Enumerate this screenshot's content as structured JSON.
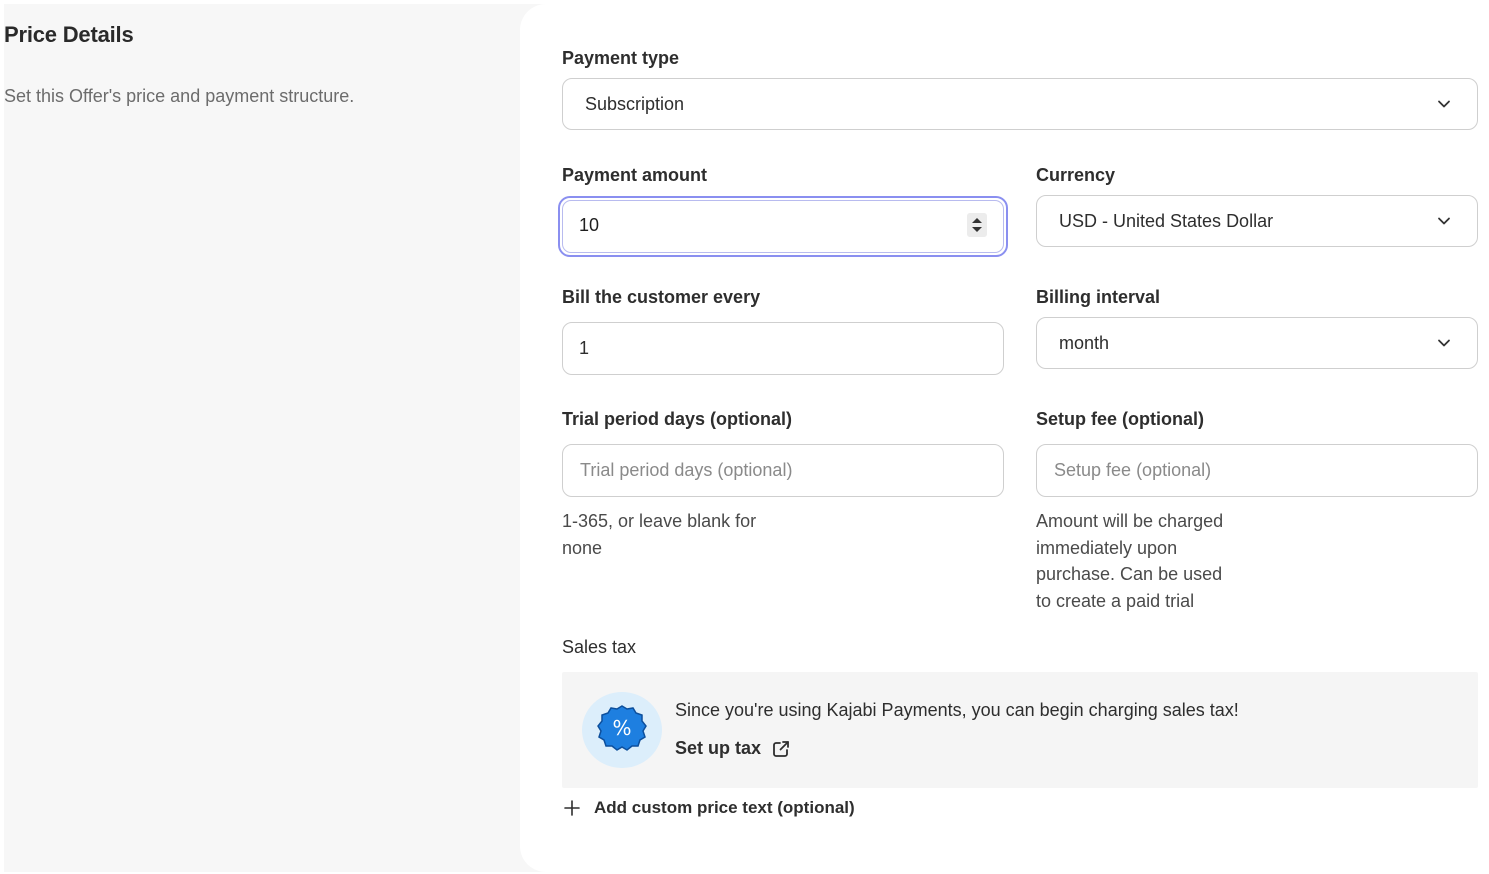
{
  "left": {
    "title": "Price Details",
    "description": "Set this Offer's price and payment structure."
  },
  "payment_type": {
    "label": "Payment type",
    "value": "Subscription"
  },
  "payment_amount": {
    "label": "Payment amount",
    "value": "10"
  },
  "currency": {
    "label": "Currency",
    "value": "USD - United States Dollar"
  },
  "bill_every": {
    "label": "Bill the customer every",
    "value": "1"
  },
  "billing_interval": {
    "label": "Billing interval",
    "value": "month"
  },
  "trial": {
    "label": "Trial period days (optional)",
    "placeholder": "Trial period days (optional)",
    "help_line1": "1-365, or leave blank for",
    "help_line2": "none"
  },
  "setup_fee": {
    "label": "Setup fee (optional)",
    "placeholder": "Setup fee (optional)",
    "help_line1": "Amount will be charged",
    "help_line2": "immediately upon",
    "help_line3": "purchase. Can be used",
    "help_line4": "to create a paid trial"
  },
  "sales_tax": {
    "label": "Sales tax",
    "message": "Since you're using Kajabi Payments, you can begin charging sales tax!",
    "link_label": "Set up tax",
    "badge_symbol": "%",
    "badge_color": "#1e7fe0"
  },
  "add_custom": {
    "label": "Add custom price text (optional)"
  },
  "colors": {
    "focus_ring": "#8a8ff0",
    "panel_bg": "#f7f7f7"
  }
}
